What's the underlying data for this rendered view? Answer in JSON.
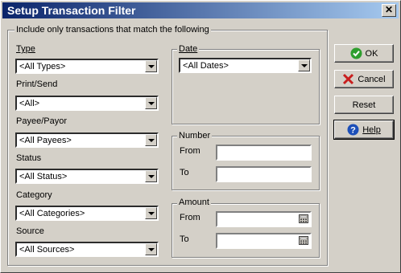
{
  "window": {
    "title": "Setup Transaction Filter",
    "close_glyph": "✕"
  },
  "filter_group": {
    "label": "Include only transactions that match the following"
  },
  "fields": {
    "type": {
      "label": "Type",
      "value": "<All Types>"
    },
    "print_send": {
      "label": "Print/Send",
      "value": "<All>"
    },
    "payee_payor": {
      "label": "Payee/Payor",
      "value": "<All Payees>"
    },
    "status": {
      "label": "Status",
      "value": "<All Status>"
    },
    "category": {
      "label": "Category",
      "value": "<All Categories>"
    },
    "source": {
      "label": "Source",
      "value": "<All Sources>"
    }
  },
  "date": {
    "label": "Date",
    "value": "<All Dates>"
  },
  "number": {
    "label": "Number",
    "from_label": "From",
    "to_label": "To",
    "from_value": "",
    "to_value": ""
  },
  "amount": {
    "label": "Amount",
    "from_label": "From",
    "to_label": "To",
    "from_value": "",
    "to_value": ""
  },
  "buttons": {
    "ok": "OK",
    "cancel": "Cancel",
    "reset": "Reset",
    "help": "Help"
  },
  "colors": {
    "title_start": "#0a246a",
    "title_end": "#a6caf0",
    "ok_green": "#2e9e2e",
    "cancel_red": "#c81e1e",
    "help_blue": "#1c4fb8"
  }
}
